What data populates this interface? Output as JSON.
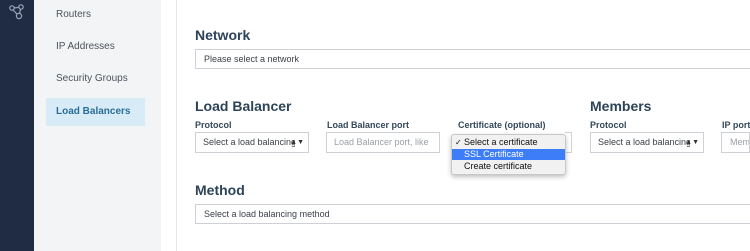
{
  "sidebar": {
    "items": [
      {
        "label": "Routers"
      },
      {
        "label": "IP Addresses"
      },
      {
        "label": "Security Groups"
      },
      {
        "label": "Load Balancers"
      }
    ]
  },
  "network": {
    "title": "Network",
    "value": "Please select a network"
  },
  "load_balancer": {
    "title": "Load Balancer",
    "protocol_label": "Protocol",
    "protocol_value": "Select a load balancing",
    "port_label": "Load Balancer port",
    "port_placeholder": "Load Balancer port, like",
    "certificate_label": "Certificate (optional)",
    "certificate_options": [
      "Select a certificate",
      "SSL Certificate",
      "Create certificate"
    ]
  },
  "members": {
    "title": "Members",
    "protocol_label": "Protocol",
    "protocol_value": "Select a load balancing",
    "ip_port_label": "IP port",
    "ip_port_placeholder": "Mem"
  },
  "method": {
    "title": "Method",
    "value": "Select a load balancing method"
  },
  "icons": {
    "rail_icon": "network-nodes-icon",
    "checkmark": "✓",
    "chevron": "▲▼"
  },
  "colors": {
    "rail": "#1f2c44",
    "active_item_bg": "#d7ecf6",
    "highlight": "#3d7df7"
  }
}
